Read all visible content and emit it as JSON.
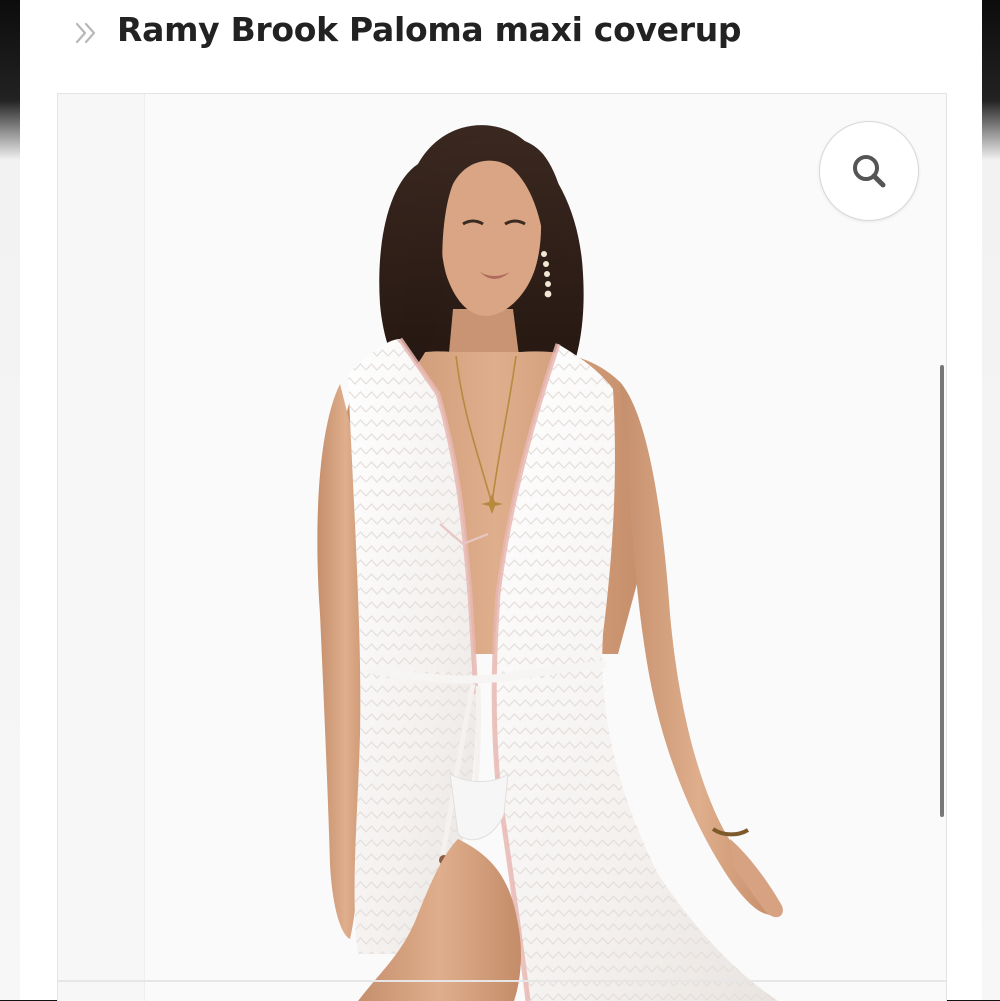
{
  "breadcrumb": {
    "icon": "double-chevron-right-icon"
  },
  "product": {
    "title": "Ramy Brook Paloma maxi coverup"
  },
  "gallery": {
    "image_alt": "Model wearing white sleeveless plunging maxi coverup tied at the waist",
    "zoom_icon": "search-icon"
  },
  "colors": {
    "page_background": "#ffffff",
    "title_text": "#222222",
    "chevron": "#b8b8b8",
    "zoom_icon": "#555555",
    "scrollbar": "#777777"
  }
}
